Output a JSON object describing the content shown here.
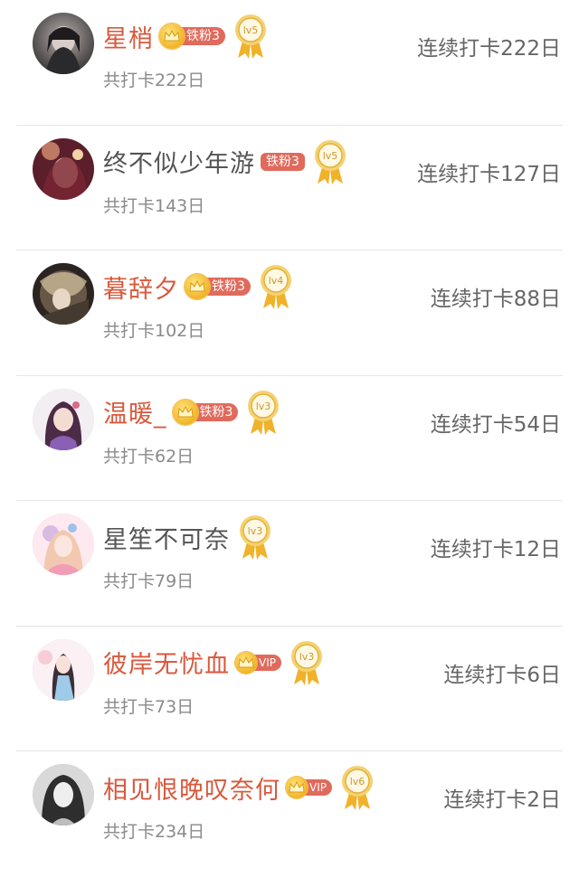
{
  "rows": [
    {
      "name": "星梢",
      "fan": "铁粉3",
      "fan_has_crown": true,
      "vip": false,
      "level": "lv5",
      "total": "共打卡222日",
      "streak": "连续打卡222日",
      "name_color": "red"
    },
    {
      "name": "终不似少年游",
      "fan": "铁粉3",
      "fan_has_crown": false,
      "vip": false,
      "level": "lv5",
      "total": "共打卡143日",
      "streak": "连续打卡127日",
      "name_color": "gray"
    },
    {
      "name": "暮辞夕",
      "fan": "铁粉3",
      "fan_has_crown": true,
      "vip": false,
      "level": "lv4",
      "total": "共打卡102日",
      "streak": "连续打卡88日",
      "name_color": "red"
    },
    {
      "name": "温暖_",
      "fan": "铁粉3",
      "fan_has_crown": true,
      "vip": false,
      "level": "lv3",
      "total": "共打卡62日",
      "streak": "连续打卡54日",
      "name_color": "red"
    },
    {
      "name": "星笙不可奈",
      "fan": "",
      "fan_has_crown": false,
      "vip": false,
      "level": "lv3",
      "total": "共打卡79日",
      "streak": "连续打卡12日",
      "name_color": "gray"
    },
    {
      "name": "彼岸无忧血",
      "fan": "",
      "fan_has_crown": false,
      "vip": true,
      "vip_label": "VIP",
      "level": "lv3",
      "total": "共打卡73日",
      "streak": "连续打卡6日",
      "name_color": "red"
    },
    {
      "name": "相见恨晚叹奈何",
      "fan": "",
      "fan_has_crown": false,
      "vip": true,
      "vip_label": "VIP",
      "level": "lv6",
      "total": "共打卡234日",
      "streak": "连续打卡2日",
      "name_color": "red"
    }
  ],
  "colors": {
    "accent": "#d9593d",
    "badge": "#e06a5c",
    "gold": "#f2b428",
    "muted": "#8a8a8a"
  },
  "icons": {
    "crown": "crown-icon",
    "medal": "level-medal-icon"
  }
}
